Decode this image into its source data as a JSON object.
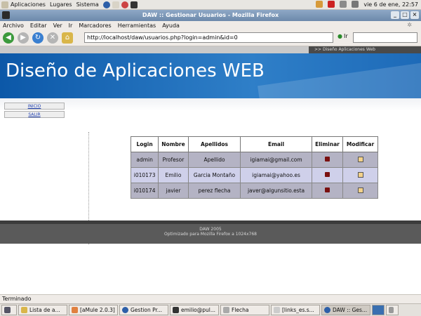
{
  "gnome_panel": {
    "menus": [
      "Aplicaciones",
      "Lugares",
      "Sistema"
    ],
    "clock": "vie  6 de ene, 22:57"
  },
  "window": {
    "title": "DAW :: Gestionar Usuarios - Mozilla Firefox"
  },
  "menubar": [
    "Archivo",
    "Editar",
    "Ver",
    "Ir",
    "Marcadores",
    "Herramientas",
    "Ayuda"
  ],
  "navbar": {
    "url": "http://localhost/daw/usuarios.php?login=admin&id=0",
    "go_label": "Ir"
  },
  "page": {
    "top_strip_label": ">> Diseño Aplicaciones Web",
    "banner_title": "Diseño de Aplicaciones WEB",
    "sidebar": [
      {
        "label": "INICIO"
      },
      {
        "label": "SALIR"
      }
    ],
    "table": {
      "headers": [
        "Login",
        "Nombre",
        "Apellidos",
        "Email",
        "Eliminar",
        "Modificar"
      ],
      "rows": [
        {
          "login": "admin",
          "nombre": "Profesor",
          "apellidos": "Apellido",
          "email": "igiamai@gmail.com"
        },
        {
          "login": "i010173",
          "nombre": "Emilio",
          "apellidos": "Garcia Montaño",
          "email": "igiamai@yahoo.es"
        },
        {
          "login": "i010174",
          "nombre": "javier",
          "apellidos": "perez flecha",
          "email": "javer@algunsitio.esta"
        }
      ]
    },
    "footer": {
      "line1": "DAW 2005",
      "line2": "Optimizado para Mozilla Firefox a 1024x768"
    }
  },
  "statusbar": {
    "text": "Terminado"
  },
  "taskbar": {
    "tasks": [
      {
        "label": "Lista de a...",
        "active": false
      },
      {
        "label": "[aMule 2.0.3]",
        "active": false
      },
      {
        "label": "Gestion Pr...",
        "active": false
      },
      {
        "label": "emilio@pul...",
        "active": false
      },
      {
        "label": "Flecha",
        "active": false
      },
      {
        "label": "[links_es.s...",
        "active": false
      },
      {
        "label": "DAW :: Ges...",
        "active": true
      }
    ]
  },
  "colors": {
    "banner_blue": "#0c58a8",
    "row_odd": "#b4b3c4",
    "row_even": "#cfd0ea",
    "footer_gray": "#5a5a5a"
  }
}
